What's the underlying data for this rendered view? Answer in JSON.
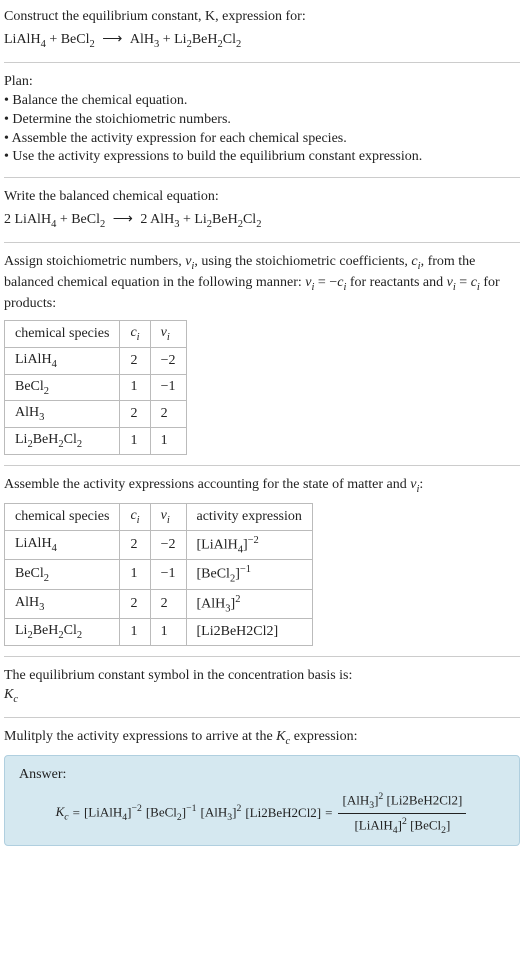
{
  "header": {
    "title": "Construct the equilibrium constant, K, expression for:",
    "equation_lhs_1": "LiAlH",
    "equation_lhs_1_sub": "4",
    "equation_plus": " + ",
    "equation_lhs_2": "BeCl",
    "equation_lhs_2_sub": "2",
    "arrow": " ⟶ ",
    "equation_rhs_1": "AlH",
    "equation_rhs_1_sub": "3",
    "equation_rhs_2": "Li",
    "equation_rhs_2_sub1": "2",
    "equation_rhs_2_mid": "BeH",
    "equation_rhs_2_sub2": "2",
    "equation_rhs_2_end": "Cl",
    "equation_rhs_2_sub3": "2"
  },
  "plan": {
    "title": "Plan:",
    "b1": "• Balance the chemical equation.",
    "b2": "• Determine the stoichiometric numbers.",
    "b3": "• Assemble the activity expression for each chemical species.",
    "b4": "• Use the activity expressions to build the equilibrium constant expression."
  },
  "balanced": {
    "title": "Write the balanced chemical equation:",
    "c1": "2 ",
    "c2": "2 "
  },
  "stoich_intro_a": "Assign stoichiometric numbers, ",
  "stoich_intro_nu": "ν",
  "stoich_intro_i": "i",
  "stoich_intro_b": ", using the stoichiometric coefficients, ",
  "stoich_intro_c": "c",
  "stoich_intro_d": ", from the balanced chemical equation in the following manner: ",
  "stoich_intro_eq1a": " = −",
  "stoich_intro_e": " for reactants and ",
  "stoich_intro_eq2a": " = ",
  "stoich_intro_f": " for products:",
  "table1": {
    "h1": "chemical species",
    "h2": "c",
    "h2sub": "i",
    "h3": "ν",
    "h3sub": "i",
    "rows": [
      {
        "sp": "LiAlH",
        "sub": "4",
        "c": "2",
        "nu": "−2"
      },
      {
        "sp": "BeCl",
        "sub": "2",
        "c": "1",
        "nu": "−1"
      },
      {
        "sp": "AlH",
        "sub": "3",
        "c": "2",
        "nu": "2"
      },
      {
        "sp_full": "Li2BeH2Cl2",
        "c": "1",
        "nu": "1"
      }
    ]
  },
  "assemble_intro": "Assemble the activity expressions accounting for the state of matter and ",
  "assemble_intro_end": ":",
  "table2": {
    "h1": "chemical species",
    "h2": "c",
    "h3": "ν",
    "h4": "activity expression",
    "rows": [
      {
        "sp": "LiAlH",
        "sub": "4",
        "c": "2",
        "nu": "−2",
        "act_base": "[LiAlH",
        "act_sub": "4",
        "act_close": "]",
        "act_exp": "−2"
      },
      {
        "sp": "BeCl",
        "sub": "2",
        "c": "1",
        "nu": "−1",
        "act_base": "[BeCl",
        "act_sub": "2",
        "act_close": "]",
        "act_exp": "−1"
      },
      {
        "sp": "AlH",
        "sub": "3",
        "c": "2",
        "nu": "2",
        "act_base": "[AlH",
        "act_sub": "3",
        "act_close": "]",
        "act_exp": "2"
      },
      {
        "sp_full": "Li2BeH2Cl2",
        "c": "1",
        "nu": "1",
        "act_full": "[Li2BeH2Cl2]"
      }
    ]
  },
  "kc_symbol_intro": "The equilibrium constant symbol in the concentration basis is:",
  "kc_label": "K",
  "kc_sub": "c",
  "multiply_intro": "Mulitply the activity expressions to arrive at the ",
  "multiply_end": " expression:",
  "answer": {
    "label": "Answer:",
    "eq_sign": " = ",
    "term1_base": "[LiAlH",
    "term1_sub": "4",
    "term1_close": "]",
    "term1_exp": "−2",
    "term2_base": "[BeCl",
    "term2_sub": "2",
    "term2_close": "]",
    "term2_exp": "−1",
    "term3_base": "[AlH",
    "term3_sub": "3",
    "term3_close": "]",
    "term3_exp": "2",
    "term4": "[Li2BeH2Cl2]",
    "num1_base": "[AlH",
    "num1_sub": "3",
    "num1_close": "]",
    "num1_exp": "2",
    "num2": "[Li2BeH2Cl2]",
    "den1_base": "[LiAlH",
    "den1_sub": "4",
    "den1_close": "]",
    "den1_exp": "2",
    "den2_base": "[BeCl",
    "den2_sub": "2",
    "den2_close": "]"
  },
  "chem": {
    "Li": "Li",
    "Al": "Al",
    "H": "H",
    "Be": "Be",
    "Cl": "Cl",
    "s2": "2",
    "s3": "3",
    "s4": "4"
  }
}
